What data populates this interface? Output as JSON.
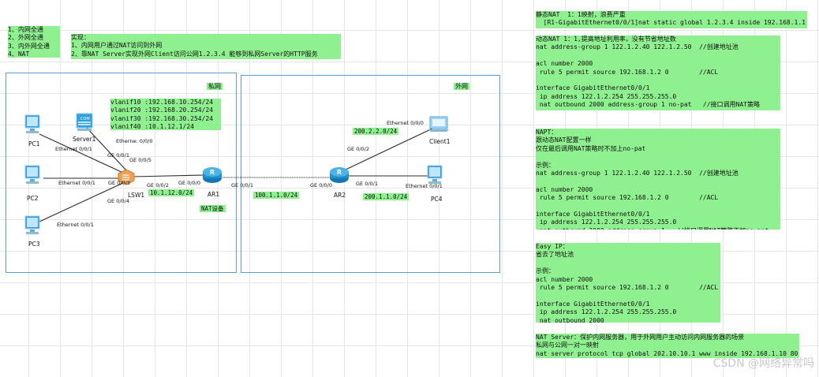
{
  "goals_note": {
    "lines": [
      "1、内网全通",
      "2、外网全通",
      "3、内外网全通",
      "4、NAT"
    ]
  },
  "impl_note": {
    "lines": [
      "实现：",
      "1、内网用户通过NAT访问到外网",
      "2、靠NAT Server实现外网Client访问公网1.2.3.4 能够到私网Server的HTTP服务"
    ]
  },
  "vlan_note": {
    "lines": [
      "vlanif10 :192.168.10.254/24",
      "vlanif20 :192.168.20.254/24",
      "vlanif30 :192.168.30.254/24",
      "vlanif40 :10.1.12.1/24"
    ]
  },
  "zones": {
    "private_label": "私网",
    "public_label": "外网"
  },
  "devices": {
    "pc1": "PC1",
    "pc2": "PC2",
    "pc3": "PC3",
    "server1": "Server1",
    "lsw1": "LSW1",
    "ar1": "AR1",
    "ar2": "AR2",
    "client1": "Client1",
    "pc4": "PC4",
    "nat_device": "NAT设备"
  },
  "ports": {
    "pc1_eth": "Ethernet 0/0/1",
    "pc2_eth": "Ethernet 0/0/1",
    "pc3_eth": "Ethernet 0/0/1",
    "server1_eth": "Etherne: 0/0/0",
    "lsw_ge001": "GE 0/0/1",
    "lsw_ge005": "GE 0/0/5",
    "lsw_ge003": "GE 0/0/3",
    "lsw_ge004": "GE 0/0/4",
    "lsw_ge002": "GE 0/0/2",
    "ar1_ge000": "GE 0/0/0",
    "ar1_ge001": "GE 0/0/1",
    "ar2_ge000": "GE 0/0/0",
    "ar2_ge002": "GE 0/0/2",
    "ar2_ge001": "GE 0/0/1",
    "client1_eth": "Ethernet 0/0/0",
    "pc4_eth": "Ethernet 0/0/1"
  },
  "subnets": {
    "lsw_ar1": "10.1.12.0/24",
    "ar1_ar2": "100.1.1.0/24",
    "ar2_client": "200.2.2.0/24",
    "ar2_pc4": "200.1.1.0/24"
  },
  "static_nat_note": {
    "lines": [
      "静态NAT  1：1映射，浪费严重",
      "  [R1-GigabitEthernet0/0/1]nat static global 1.2.3.4 inside 192.168.1.1"
    ]
  },
  "dynamic_nat_note": {
    "lines": [
      "动态NAT 1：1,提高地址利用率，没有节省地址数",
      "nat address-group 1 122.1.2.40 122.1.2.50  //创建地址池",
      "",
      "acl number 2000",
      " rule 5 permit source 192.168.1.2 0        //ACL",
      "",
      "interface GigabitEthernet0/0/1",
      " ip address 122.1.2.254 255.255.255.0",
      " nat outbound 2000 address-group 1 no-pat   //接口调用NAT策略"
    ]
  },
  "napt_note": {
    "lines": [
      "NAPT：",
      "跟动态NAT配置一样",
      "仅在最后调用NAT策略时不加上no-pat",
      "",
      "示例：",
      "nat address-group 1 122.1.2.40 122.1.2.50  //创建地址池",
      "",
      "acl number 2000",
      " rule 5 permit source 192.168.1.2 0        //ACL",
      "",
      "interface GigabitEthernet0/0/1",
      " ip address 122.1.2.254 255.255.255.0",
      " nat outbound 2000 address-group 1   //接口调用NAT策略不加no-pat"
    ]
  },
  "easyip_note": {
    "lines": [
      "Easy IP：",
      "省去了地址池",
      "",
      "示例：",
      "acl number 2000",
      " rule 5 permit source 192.168.1.2 0        //ACL",
      "",
      "interface GigabitEthernet0/0/1",
      " ip address 122.1.2.254 255.255.255.0",
      " nat outbound 2000"
    ]
  },
  "natserver_note": {
    "lines": [
      "NAT Server：保护内网服务器，用于外网用户主动访问内网服务器的场景",
      "私网与公网一对一映射",
      "nat server protocol tcp global 202.10.10.1 www inside 192.168.1.10 80"
    ]
  },
  "watermark": "CSDN @网络异常吗",
  "colors": {
    "note_bg": "#8ef08e",
    "zone_border": "#5b9bd5",
    "router": "#1f8fc9",
    "switch": "#f0a050",
    "pc_screen": "#2f9fe0"
  }
}
